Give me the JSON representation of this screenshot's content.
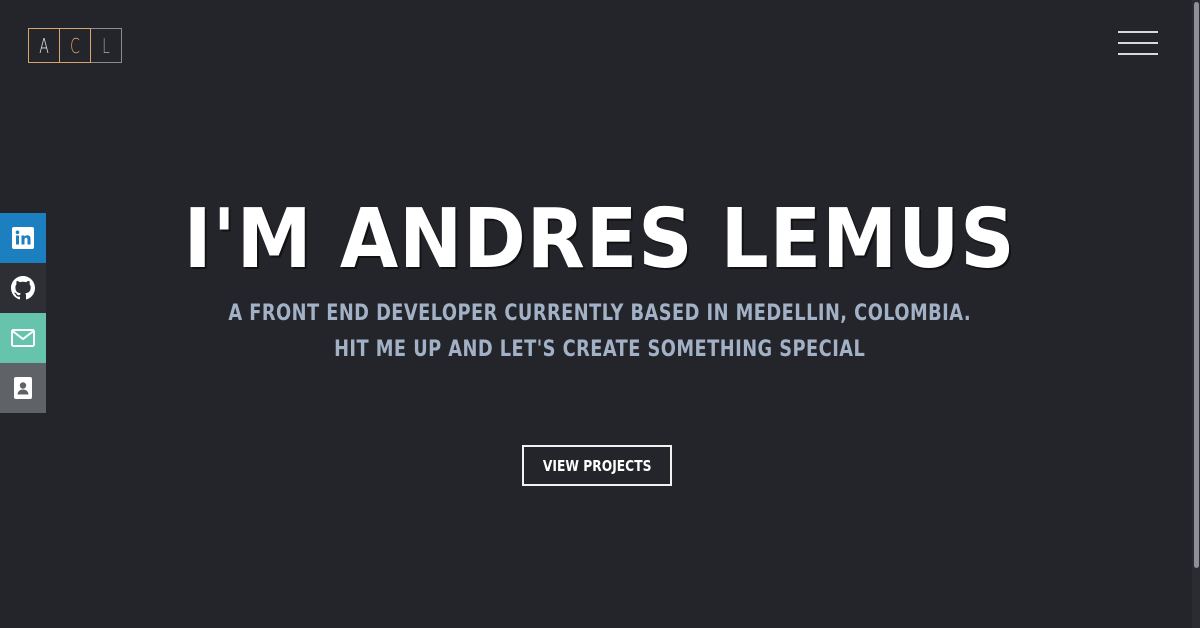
{
  "logo": {
    "letters": [
      "A",
      "C",
      "L"
    ]
  },
  "menu": {
    "icon": "hamburger-menu-icon"
  },
  "social": {
    "items": [
      {
        "name": "linkedin",
        "icon": "linkedin-icon",
        "color": "#1c7fc0"
      },
      {
        "name": "github",
        "icon": "github-icon",
        "color": "#2e2f34"
      },
      {
        "name": "email",
        "icon": "mail-icon",
        "color": "#66c4ac"
      },
      {
        "name": "contact",
        "icon": "contact-card-icon",
        "color": "#5f6368"
      }
    ]
  },
  "hero": {
    "title": "I'M ANDRES LEMUS",
    "subtitle_line1": "A FRONT END DEVELOPER CURRENTLY BASED IN MEDELLIN, COLOMBIA.",
    "subtitle_line2": "HIT ME UP AND LET'S CREATE SOMETHING SPECIAL",
    "cta_label": "VIEW PROJECTS"
  },
  "colors": {
    "background": "#23252a",
    "accent": "#e0a25c",
    "subtitle": "#a3b1c6"
  }
}
